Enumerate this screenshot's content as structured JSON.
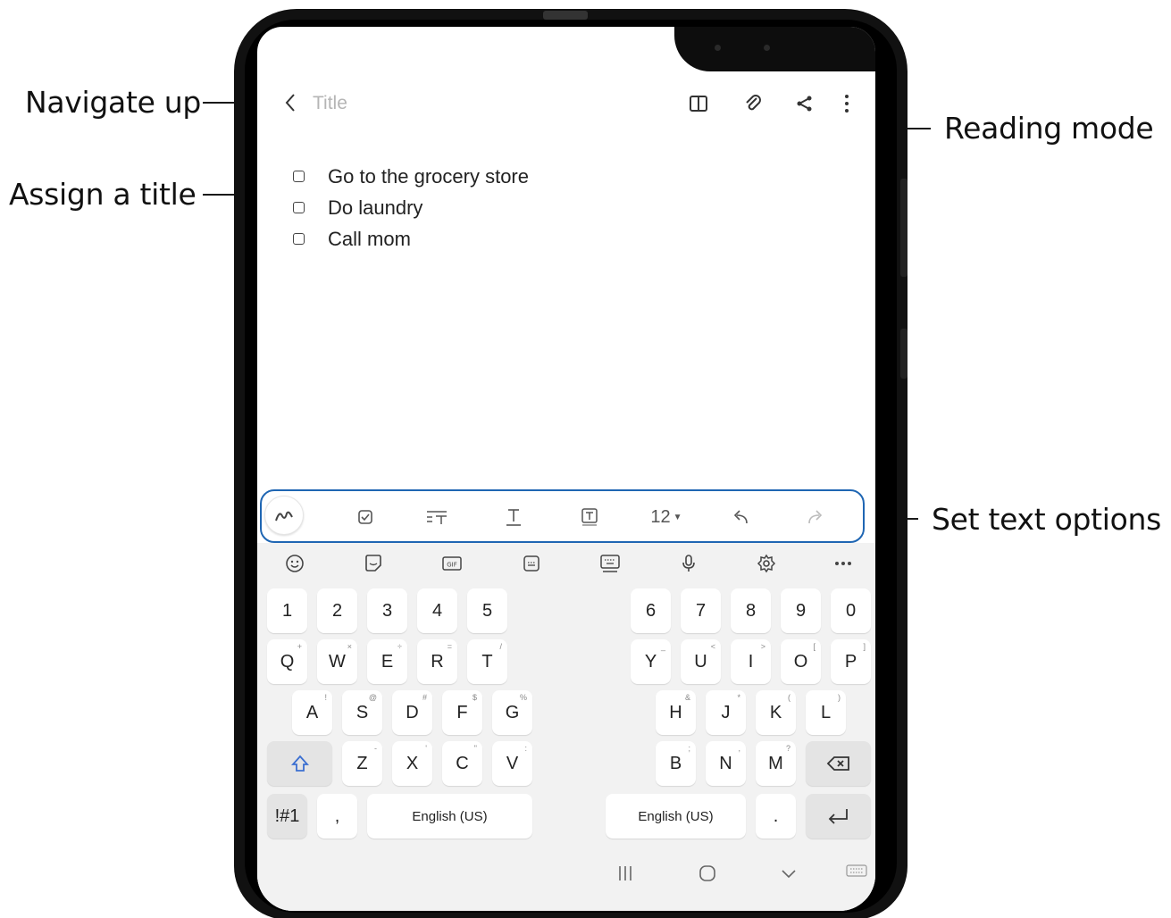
{
  "callouts": {
    "navigate_up": "Navigate up",
    "assign_title": "Assign a title",
    "reading_mode": "Reading mode",
    "set_text_options": "Set text options"
  },
  "appbar": {
    "back_icon": "chevron-left-icon",
    "title_placeholder": "Title",
    "icons": [
      "reading-mode-icon",
      "attach-icon",
      "share-icon",
      "more-options-icon"
    ]
  },
  "note": {
    "items": [
      {
        "text": "Go to the grocery store",
        "checked": false
      },
      {
        "text": "Do laundry",
        "checked": false
      },
      {
        "text": "Call mom",
        "checked": false
      }
    ]
  },
  "toolbar": {
    "font_size": "12",
    "tools": [
      "handwriting-icon",
      "checkbox-icon",
      "paragraph-style-icon",
      "text-style-icon",
      "text-color-icon",
      "font-size-dropdown",
      "undo-icon",
      "redo-icon"
    ]
  },
  "keyboard": {
    "top_icons": [
      "emoji-icon",
      "sticker-icon",
      "gif-icon",
      "keyboard-clipboard-icon",
      "keyboard-layout-icon",
      "mic-icon",
      "settings-icon",
      "more-icon"
    ],
    "row_numbers_left": [
      "1",
      "2",
      "3",
      "4",
      "5"
    ],
    "row_numbers_right": [
      "6",
      "7",
      "8",
      "9",
      "0"
    ],
    "row_q_left": [
      "Q",
      "W",
      "E",
      "R",
      "T"
    ],
    "row_q_left_sub": [
      "+",
      "×",
      "÷",
      "=",
      "/"
    ],
    "row_q_right": [
      "Y",
      "U",
      "I",
      "O",
      "P"
    ],
    "row_q_right_sub": [
      "_",
      "<",
      ">",
      "[",
      "]"
    ],
    "row_a_left": [
      "A",
      "S",
      "D",
      "F",
      "G"
    ],
    "row_a_left_sub": [
      "!",
      "@",
      "#",
      "$",
      "%"
    ],
    "row_a_right": [
      "H",
      "J",
      "K",
      "L"
    ],
    "row_a_right_sub": [
      "&",
      "*",
      "(",
      ")"
    ],
    "row_z_left": [
      "Z",
      "X",
      "C",
      "V"
    ],
    "row_z_left_sub": [
      "-",
      "'",
      "\"",
      ":"
    ],
    "row_z_right": [
      "B",
      "N",
      "M"
    ],
    "row_z_right_sub": [
      ";",
      ",",
      "?"
    ],
    "symbols_key": "!#1",
    "comma_key": ",",
    "period_key": ".",
    "space_left": "English (US)",
    "space_right": "English (US)"
  },
  "colors": {
    "accent": "#3b6fd1",
    "callout_line": "#1f66b3"
  }
}
